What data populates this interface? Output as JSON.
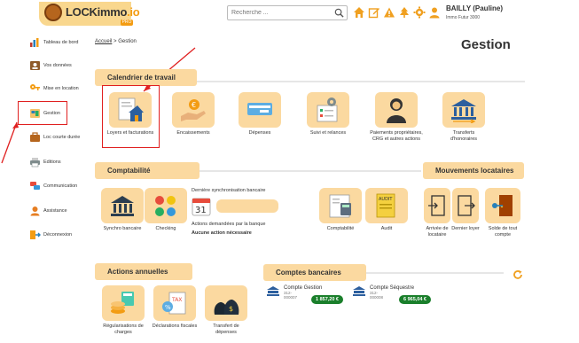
{
  "app": {
    "logo_text": "LOCKimmo",
    "logo_suffix": ".io",
    "logo_badge": "PRO"
  },
  "search": {
    "placeholder": "Recherche ..."
  },
  "header_icons": [
    "home-icon",
    "edit-icon",
    "warning-icon",
    "tree-icon",
    "settings-icon",
    "user-icon"
  ],
  "user": {
    "name": "BAILLY (Pauline)",
    "company": "Immo Futur 3000"
  },
  "sidebar": {
    "items": [
      {
        "label": "Tableau de bord",
        "icon": "dashboard-icon"
      },
      {
        "label": "Vos données",
        "icon": "data-icon"
      },
      {
        "label": "Mise en location",
        "icon": "keys-icon"
      },
      {
        "label": "Gestion",
        "icon": "management-icon"
      },
      {
        "label": "Loc courte durée",
        "icon": "short-rental-icon"
      },
      {
        "label": "Editions",
        "icon": "print-icon"
      },
      {
        "label": "Communication",
        "icon": "chat-icon"
      },
      {
        "label": "Assistance",
        "icon": "support-icon"
      },
      {
        "label": "Déconnexion",
        "icon": "logout-icon"
      }
    ]
  },
  "breadcrumb": {
    "home": "Accueil",
    "sep": ">",
    "current": "Gestion"
  },
  "page_title": "Gestion",
  "sections": {
    "calendrier": {
      "title": "Calendrier de travail",
      "tiles": [
        {
          "label": "Loyers et facturations"
        },
        {
          "label": "Encaissements"
        },
        {
          "label": "Dépenses"
        },
        {
          "label": "Suivi et relances"
        },
        {
          "label": "Paiements propriétaires, CRG et autres actions"
        },
        {
          "label": "Transferts d'honoraires"
        }
      ]
    },
    "comptabilite": {
      "title": "Comptabilité",
      "tiles": [
        {
          "label": "Synchro bancaire"
        },
        {
          "label": "Checking"
        },
        {
          "label": "Comptabilité"
        },
        {
          "label": "Audit"
        }
      ],
      "sync_title": "Dernière synchronisation bancaire",
      "calendar_day": "31",
      "actions_title": "Actions demandées par la banque",
      "actions_value": "Aucune action nécessaire"
    },
    "mouvements": {
      "title": "Mouvements locataires",
      "tiles": [
        {
          "label": "Arrivée de locataire"
        },
        {
          "label": "Dernier loyer"
        },
        {
          "label": "Solde de tout compte"
        }
      ]
    },
    "annuelles": {
      "title": "Actions annuelles",
      "tiles": [
        {
          "label": "Régularisations de charges"
        },
        {
          "label": "Déclarations fiscales"
        },
        {
          "label": "Transfert de dépenses"
        }
      ]
    },
    "banque": {
      "title": "Comptes bancaires",
      "accounts": [
        {
          "name": "Compte Gestion",
          "iban_line1": "312-",
          "iban_line2": "000007",
          "amount": "1 857,20 €"
        },
        {
          "name": "Compte Séquestre",
          "iban_line1": "312-",
          "iban_line2": "000008",
          "amount": "6 965,04 €"
        }
      ]
    }
  },
  "colors": {
    "accent": "#fbd9a0",
    "brand": "#f39c12",
    "highlight": "#e02020",
    "positive": "#1a7f2b"
  }
}
